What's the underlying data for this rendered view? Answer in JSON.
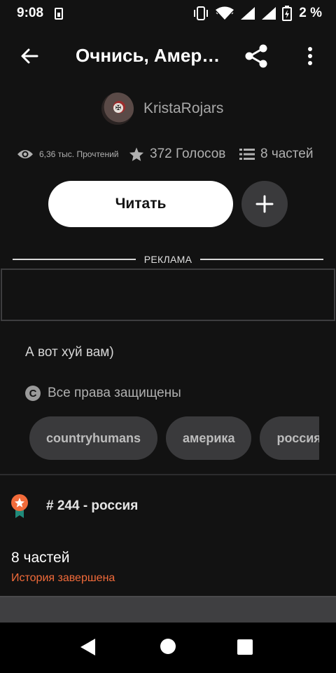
{
  "status_bar": {
    "time": "9:08",
    "battery_text": "2 %"
  },
  "header": {
    "title": "Очнись, Америка!",
    "back_icon": "arrow-left-icon",
    "share_icon": "share-icon",
    "more_icon": "more-vert-icon"
  },
  "author": {
    "name": "KristaRojars"
  },
  "stats": {
    "reads": "6,36 тыс. Прочтений",
    "votes": "372 Голосов",
    "parts": "8 частей"
  },
  "actions": {
    "read_label": "Читать",
    "add_icon": "plus-icon"
  },
  "ad": {
    "label": "РЕКЛАМА"
  },
  "description": {
    "text": "А вот хуй вам)",
    "copyright": "Все права защищены"
  },
  "tags": [
    "countryhumans",
    "америка",
    "россия"
  ],
  "ranking": {
    "text": "# 244 - россия"
  },
  "chapters": {
    "count_label": "8 частей",
    "status": "История завершена"
  },
  "colors": {
    "background": "#121212",
    "accent_orange": "#f26b3a",
    "chip": "#3a3a3c"
  }
}
